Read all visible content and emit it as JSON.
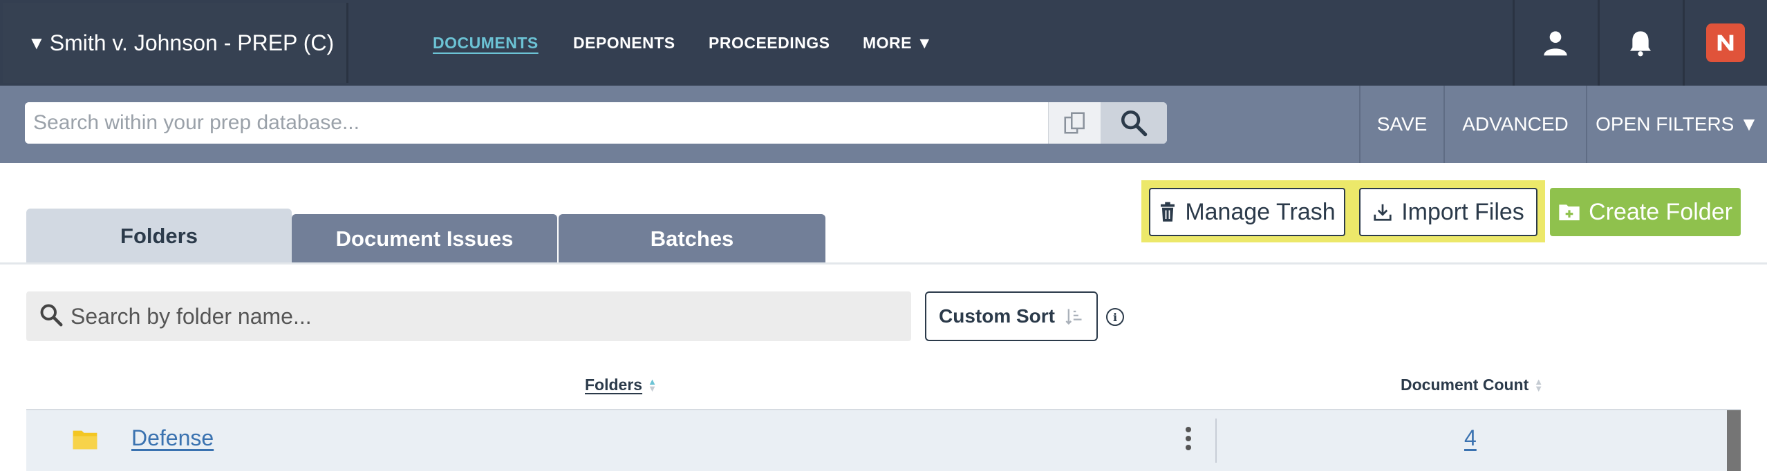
{
  "header": {
    "case_title": "Smith v. Johnson - PREP (C)",
    "case_toggle_icon": "triangle-down-icon",
    "nav": [
      {
        "label": "DOCUMENTS",
        "active": true
      },
      {
        "label": "DEPONENTS",
        "active": false
      },
      {
        "label": "PROCEEDINGS",
        "active": false
      },
      {
        "label": "MORE ▼",
        "active": false
      }
    ],
    "icons": [
      "user-icon",
      "bell-icon",
      "brand-logo-icon"
    ]
  },
  "search": {
    "placeholder": "Search within your prep database...",
    "value": "",
    "buttons": {
      "save": "SAVE",
      "advanced": "ADVANCED",
      "open_filters": "OPEN FILTERS ▼"
    }
  },
  "tabs": [
    {
      "label": "Folders",
      "active": true
    },
    {
      "label": "Document Issues",
      "active": false
    },
    {
      "label": "Batches",
      "active": false
    }
  ],
  "actions": {
    "manage_trash": "Manage Trash",
    "import_files": "Import Files",
    "create_folder": "Create Folder",
    "highlight_color": "#ece86a",
    "create_color": "#8fc14d"
  },
  "folder_search": {
    "placeholder": "Search by folder name...",
    "sort_label": "Custom Sort"
  },
  "table": {
    "columns": [
      "Folders",
      "Document Count"
    ],
    "rows": [
      {
        "name": "Defense",
        "count": "4"
      }
    ]
  },
  "colors": {
    "nav_bg": "#343f51",
    "search_bg": "#717f98",
    "active_nav": "#6cc3d5",
    "link": "#3a72b0"
  }
}
